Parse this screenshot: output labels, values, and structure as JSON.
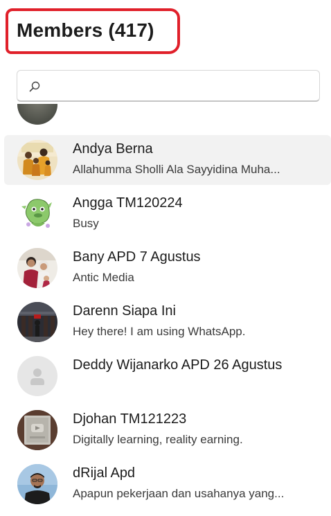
{
  "header": {
    "title": "Members (417)",
    "highlight_color": "#e0202a"
  },
  "search": {
    "value": "",
    "placeholder": "",
    "icon": "search-icon"
  },
  "members": [
    {
      "name": "Andya Berna",
      "status": "Allahumma Sholli Ala Sayyidina Muha...",
      "avatar": "family-photo",
      "selected": true
    },
    {
      "name": "Angga TM120224",
      "status": "Busy",
      "avatar": "green-mascot-sticker",
      "selected": false
    },
    {
      "name": "Bany APD 7 Agustus",
      "status": "Antic Media",
      "avatar": "couple-photo",
      "selected": false
    },
    {
      "name": "Darenn Siapa Ini",
      "status": "Hey there! I am using WhatsApp.",
      "avatar": "building-photo",
      "selected": false
    },
    {
      "name": "Deddy Wijanarko APD 26 Agustus",
      "status": "",
      "avatar": "default-person-icon",
      "selected": false
    },
    {
      "name": "Djohan TM121223",
      "status": "Digitally learning, reality earning.",
      "avatar": "play-button-award-photo",
      "selected": false
    },
    {
      "name": "dRijal Apd",
      "status": "Apapun pekerjaan dan usahanya yang...",
      "avatar": "man-portrait-photo",
      "selected": false
    }
  ],
  "colors": {
    "selected_row": "#f2f2f2",
    "default_avatar_bg": "#e6e6e6",
    "default_avatar_fg": "#c8c8c8"
  }
}
